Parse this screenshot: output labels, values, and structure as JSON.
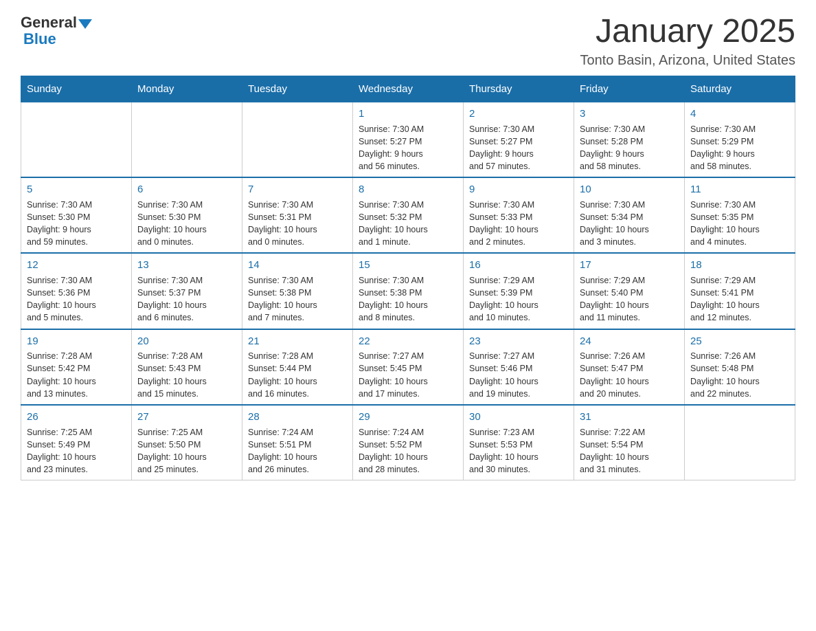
{
  "logo": {
    "general": "General",
    "blue": "Blue"
  },
  "title": "January 2025",
  "subtitle": "Tonto Basin, Arizona, United States",
  "days_header": [
    "Sunday",
    "Monday",
    "Tuesday",
    "Wednesday",
    "Thursday",
    "Friday",
    "Saturday"
  ],
  "weeks": [
    [
      {
        "day": "",
        "info": ""
      },
      {
        "day": "",
        "info": ""
      },
      {
        "day": "",
        "info": ""
      },
      {
        "day": "1",
        "info": "Sunrise: 7:30 AM\nSunset: 5:27 PM\nDaylight: 9 hours\nand 56 minutes."
      },
      {
        "day": "2",
        "info": "Sunrise: 7:30 AM\nSunset: 5:27 PM\nDaylight: 9 hours\nand 57 minutes."
      },
      {
        "day": "3",
        "info": "Sunrise: 7:30 AM\nSunset: 5:28 PM\nDaylight: 9 hours\nand 58 minutes."
      },
      {
        "day": "4",
        "info": "Sunrise: 7:30 AM\nSunset: 5:29 PM\nDaylight: 9 hours\nand 58 minutes."
      }
    ],
    [
      {
        "day": "5",
        "info": "Sunrise: 7:30 AM\nSunset: 5:30 PM\nDaylight: 9 hours\nand 59 minutes."
      },
      {
        "day": "6",
        "info": "Sunrise: 7:30 AM\nSunset: 5:30 PM\nDaylight: 10 hours\nand 0 minutes."
      },
      {
        "day": "7",
        "info": "Sunrise: 7:30 AM\nSunset: 5:31 PM\nDaylight: 10 hours\nand 0 minutes."
      },
      {
        "day": "8",
        "info": "Sunrise: 7:30 AM\nSunset: 5:32 PM\nDaylight: 10 hours\nand 1 minute."
      },
      {
        "day": "9",
        "info": "Sunrise: 7:30 AM\nSunset: 5:33 PM\nDaylight: 10 hours\nand 2 minutes."
      },
      {
        "day": "10",
        "info": "Sunrise: 7:30 AM\nSunset: 5:34 PM\nDaylight: 10 hours\nand 3 minutes."
      },
      {
        "day": "11",
        "info": "Sunrise: 7:30 AM\nSunset: 5:35 PM\nDaylight: 10 hours\nand 4 minutes."
      }
    ],
    [
      {
        "day": "12",
        "info": "Sunrise: 7:30 AM\nSunset: 5:36 PM\nDaylight: 10 hours\nand 5 minutes."
      },
      {
        "day": "13",
        "info": "Sunrise: 7:30 AM\nSunset: 5:37 PM\nDaylight: 10 hours\nand 6 minutes."
      },
      {
        "day": "14",
        "info": "Sunrise: 7:30 AM\nSunset: 5:38 PM\nDaylight: 10 hours\nand 7 minutes."
      },
      {
        "day": "15",
        "info": "Sunrise: 7:30 AM\nSunset: 5:38 PM\nDaylight: 10 hours\nand 8 minutes."
      },
      {
        "day": "16",
        "info": "Sunrise: 7:29 AM\nSunset: 5:39 PM\nDaylight: 10 hours\nand 10 minutes."
      },
      {
        "day": "17",
        "info": "Sunrise: 7:29 AM\nSunset: 5:40 PM\nDaylight: 10 hours\nand 11 minutes."
      },
      {
        "day": "18",
        "info": "Sunrise: 7:29 AM\nSunset: 5:41 PM\nDaylight: 10 hours\nand 12 minutes."
      }
    ],
    [
      {
        "day": "19",
        "info": "Sunrise: 7:28 AM\nSunset: 5:42 PM\nDaylight: 10 hours\nand 13 minutes."
      },
      {
        "day": "20",
        "info": "Sunrise: 7:28 AM\nSunset: 5:43 PM\nDaylight: 10 hours\nand 15 minutes."
      },
      {
        "day": "21",
        "info": "Sunrise: 7:28 AM\nSunset: 5:44 PM\nDaylight: 10 hours\nand 16 minutes."
      },
      {
        "day": "22",
        "info": "Sunrise: 7:27 AM\nSunset: 5:45 PM\nDaylight: 10 hours\nand 17 minutes."
      },
      {
        "day": "23",
        "info": "Sunrise: 7:27 AM\nSunset: 5:46 PM\nDaylight: 10 hours\nand 19 minutes."
      },
      {
        "day": "24",
        "info": "Sunrise: 7:26 AM\nSunset: 5:47 PM\nDaylight: 10 hours\nand 20 minutes."
      },
      {
        "day": "25",
        "info": "Sunrise: 7:26 AM\nSunset: 5:48 PM\nDaylight: 10 hours\nand 22 minutes."
      }
    ],
    [
      {
        "day": "26",
        "info": "Sunrise: 7:25 AM\nSunset: 5:49 PM\nDaylight: 10 hours\nand 23 minutes."
      },
      {
        "day": "27",
        "info": "Sunrise: 7:25 AM\nSunset: 5:50 PM\nDaylight: 10 hours\nand 25 minutes."
      },
      {
        "day": "28",
        "info": "Sunrise: 7:24 AM\nSunset: 5:51 PM\nDaylight: 10 hours\nand 26 minutes."
      },
      {
        "day": "29",
        "info": "Sunrise: 7:24 AM\nSunset: 5:52 PM\nDaylight: 10 hours\nand 28 minutes."
      },
      {
        "day": "30",
        "info": "Sunrise: 7:23 AM\nSunset: 5:53 PM\nDaylight: 10 hours\nand 30 minutes."
      },
      {
        "day": "31",
        "info": "Sunrise: 7:22 AM\nSunset: 5:54 PM\nDaylight: 10 hours\nand 31 minutes."
      },
      {
        "day": "",
        "info": ""
      }
    ]
  ]
}
